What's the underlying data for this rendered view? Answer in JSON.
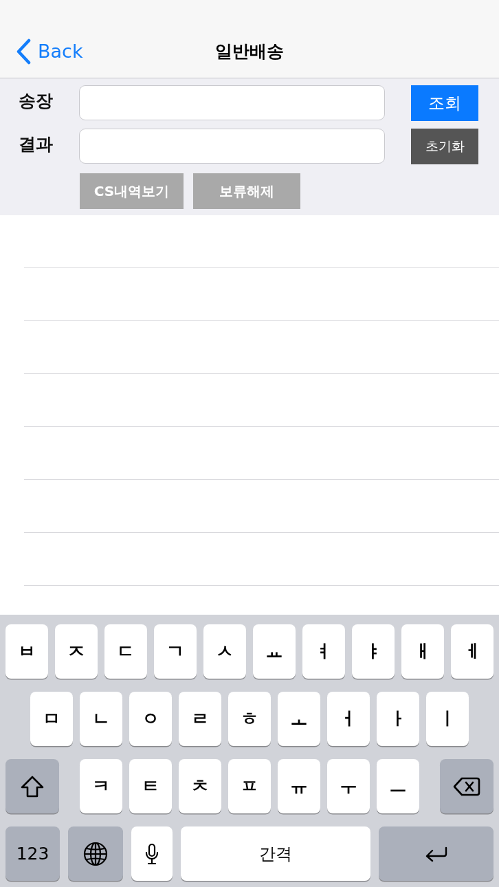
{
  "nav_bar": {
    "back_label": "Back",
    "title": "일반배송"
  },
  "form": {
    "rows": [
      {
        "label": "송장",
        "button": {
          "label": "조회",
          "kind": "primary"
        }
      },
      {
        "label": "결과",
        "button": {
          "label": "초기화",
          "kind": "dark"
        }
      }
    ],
    "actions": [
      {
        "label": "CS내역보기",
        "kind": "muted"
      },
      {
        "label": "보류해제",
        "kind": "muted"
      }
    ]
  },
  "keyboard": {
    "rows": [
      [
        {
          "kind": "letter",
          "label": "ㅂ"
        },
        {
          "kind": "letter",
          "label": "ㅈ"
        },
        {
          "kind": "letter",
          "label": "ㄷ"
        },
        {
          "kind": "letter",
          "label": "ㄱ"
        },
        {
          "kind": "letter",
          "label": "ㅅ"
        },
        {
          "kind": "letter",
          "label": "ㅛ"
        },
        {
          "kind": "letter",
          "label": "ㅕ"
        },
        {
          "kind": "letter",
          "label": "ㅑ"
        },
        {
          "kind": "letter",
          "label": "ㅐ"
        },
        {
          "kind": "letter",
          "label": "ㅔ"
        }
      ],
      [
        {
          "kind": "letter",
          "label": "ㅁ"
        },
        {
          "kind": "letter",
          "label": "ㄴ"
        },
        {
          "kind": "letter",
          "label": "ㅇ"
        },
        {
          "kind": "letter",
          "label": "ㄹ"
        },
        {
          "kind": "letter",
          "label": "ㅎ"
        },
        {
          "kind": "letter",
          "label": "ㅗ"
        },
        {
          "kind": "letter",
          "label": "ㅓ"
        },
        {
          "kind": "letter",
          "label": "ㅏ"
        },
        {
          "kind": "letter",
          "label": "ㅣ"
        }
      ],
      [
        {
          "kind": "shift"
        },
        {
          "kind": "letter",
          "label": "ㅋ"
        },
        {
          "kind": "letter",
          "label": "ㅌ"
        },
        {
          "kind": "letter",
          "label": "ㅊ"
        },
        {
          "kind": "letter",
          "label": "ㅍ"
        },
        {
          "kind": "letter",
          "label": "ㅠ"
        },
        {
          "kind": "letter",
          "label": "ㅜ"
        },
        {
          "kind": "letter",
          "label": "ㅡ"
        },
        {
          "kind": "backspace"
        }
      ],
      [
        {
          "kind": "numbers",
          "label": "123"
        },
        {
          "kind": "globe"
        },
        {
          "kind": "mic"
        },
        {
          "kind": "space",
          "label": "간격"
        },
        {
          "kind": "return"
        }
      ]
    ]
  }
}
